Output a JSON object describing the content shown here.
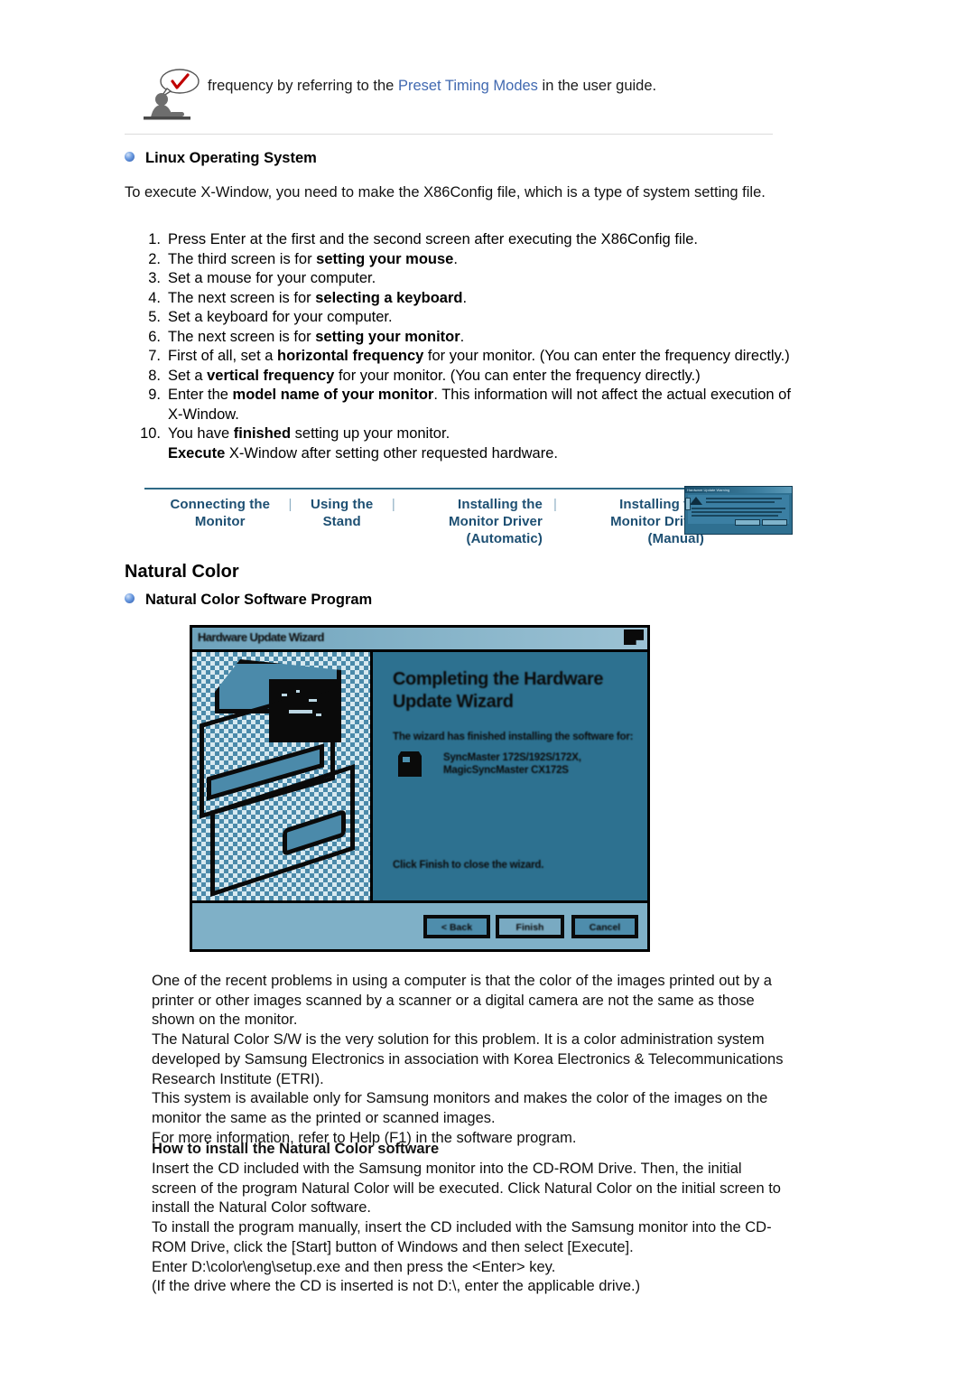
{
  "note": {
    "icon": "tip-person-icon",
    "text_before": "frequency by referring to the ",
    "link_text": "Preset Timing Modes",
    "text_after": " in the user guide."
  },
  "linux_section": {
    "heading": "Linux Operating System",
    "intro": "To execute X-Window, you need to make the X86Config file, which is a type of system setting file.",
    "steps": [
      {
        "num": "1.",
        "html": "Press Enter at the first and the second screen after executing the X86Config file."
      },
      {
        "num": "2.",
        "html": "The third screen is for <b>setting your mouse</b>."
      },
      {
        "num": "3.",
        "html": "Set a mouse for your computer."
      },
      {
        "num": "4.",
        "html": "The next screen is for <b>selecting a keyboard</b>."
      },
      {
        "num": "5.",
        "html": "Set a keyboard for your computer."
      },
      {
        "num": "6.",
        "html": "The next screen is for <b>setting your monitor</b>."
      },
      {
        "num": "7.",
        "html": "First of all, set a <b>horizontal frequency</b> for your monitor. (You can enter the frequency directly.)"
      },
      {
        "num": "8.",
        "html": "Set a <b>vertical frequency</b> for your monitor. (You can enter the frequency directly.)"
      },
      {
        "num": "9.",
        "html": "Enter the <b>model name of your monitor</b>. This information will not affect the actual execution of X-Window."
      },
      {
        "num": "10.",
        "html": "You have <b>finished</b> setting up your monitor."
      }
    ],
    "step10_sub": "<b>Execute</b> X-Window after setting other requested hardware."
  },
  "navbar": {
    "links": [
      {
        "label": "Connecting  the Monitor"
      },
      {
        "label": "Using the Stand"
      },
      {
        "label": "Installing the Monitor Driver\n(Automatic)"
      },
      {
        "label": "Installing the Monitor Driver\n(Manual)"
      }
    ],
    "separator": "|",
    "thumbnail_name": "monitor-driver-dialog-thumbnail",
    "thumbnail_title": "Hardware Update Warning"
  },
  "natural_color": {
    "section_title": "Natural Color",
    "bullet_heading": "Natural Color Software Program",
    "wizard": {
      "window_title": "Hardware Update Wizard",
      "heading": "Completing the Hardware Update Wizard",
      "subtext": "The wizard has finished installing the software for:",
      "device": "SyncMaster 172S/192S/172X, MagicSyncMaster CX172S",
      "footer_note": "Click Finish to close the wizard.",
      "buttons": [
        "< Back",
        "Finish",
        "Cancel"
      ]
    },
    "paragraphs": [
      "One of the recent problems in using a computer is that the color of the images printed out by a printer or other images scanned by a scanner or a digital camera are not the same as those shown on the monitor.",
      "The Natural Color S/W is the very solution for this problem. It is a color administration system developed by Samsung Electronics in association with Korea Electronics & Telecommunications Research Institute (ETRI).",
      "This system is available only for Samsung monitors and makes the color of the images on the monitor the same as the printed or scanned images.",
      "For more information, refer to Help (F1) in the software program."
    ],
    "install_heading": "How to install the Natural Color software",
    "install_paragraphs": [
      "Insert the CD included with the Samsung monitor into the CD-ROM Drive. Then, the initial screen of the program Natural Color will be executed. Click Natural Color on the initial screen to install the Natural Color software.",
      "To install the program manually, insert the CD included with the Samsung monitor into the CD-ROM Drive, click the [Start] button of Windows and then select [Execute].",
      "Enter D:\\color\\eng\\setup.exe and then press the <Enter> key.",
      "(If the drive where the CD is inserted is not D:\\, enter the applicable drive.)"
    ]
  },
  "colors": {
    "link": "#4169b0",
    "nav_link": "#1d4f72",
    "wizard_bg": "#2d7190",
    "wizard_footer": "#7fb0c7"
  }
}
